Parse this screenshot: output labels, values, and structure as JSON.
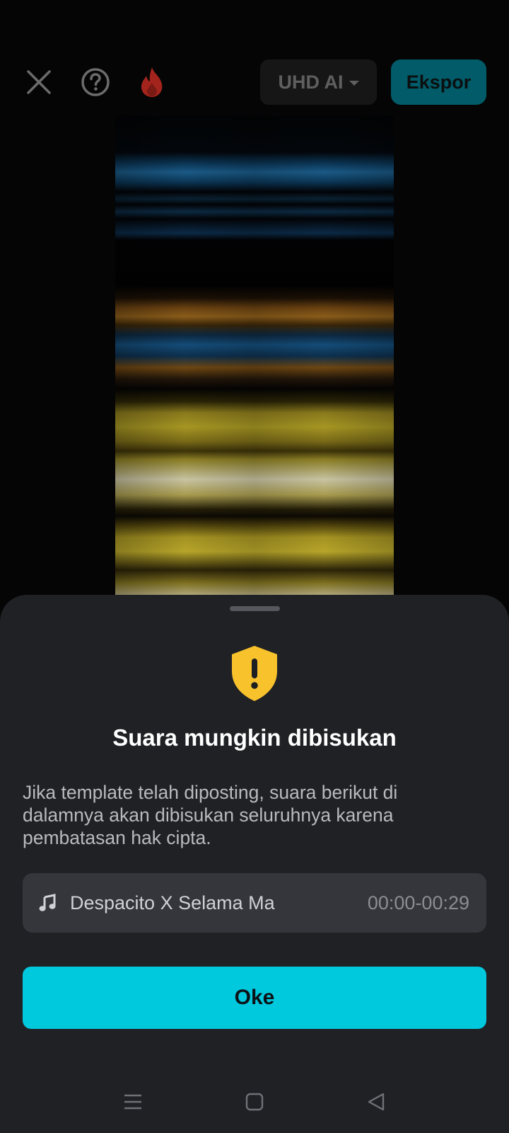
{
  "toolbar": {
    "close_icon": "close-icon",
    "help_icon": "help-circle-icon",
    "fire_icon": "fire-icon",
    "quality_label": "UHD AI",
    "export_label": "Ekspor"
  },
  "dialog": {
    "icon": "shield-warning-icon",
    "title": "Suara mungkin dibisukan",
    "body": "Jika template telah diposting, suara berikut di dalamnya akan dibisukan seluruhnya karena pembatasan hak cipta.",
    "track": {
      "icon": "music-note-icon",
      "title": "Despacito X Selama Mata…",
      "time_range": "00:00-00:29"
    },
    "ok_label": "Oke"
  },
  "navbar": {
    "menu_icon": "menu-icon",
    "home_icon": "home-square-icon",
    "back_icon": "back-triangle-icon"
  },
  "colors": {
    "accent": "#00c8dd",
    "export_bg": "#015b68",
    "sheet_bg": "#202125",
    "warning": "#f7c22c",
    "fire": "#a3241c"
  }
}
